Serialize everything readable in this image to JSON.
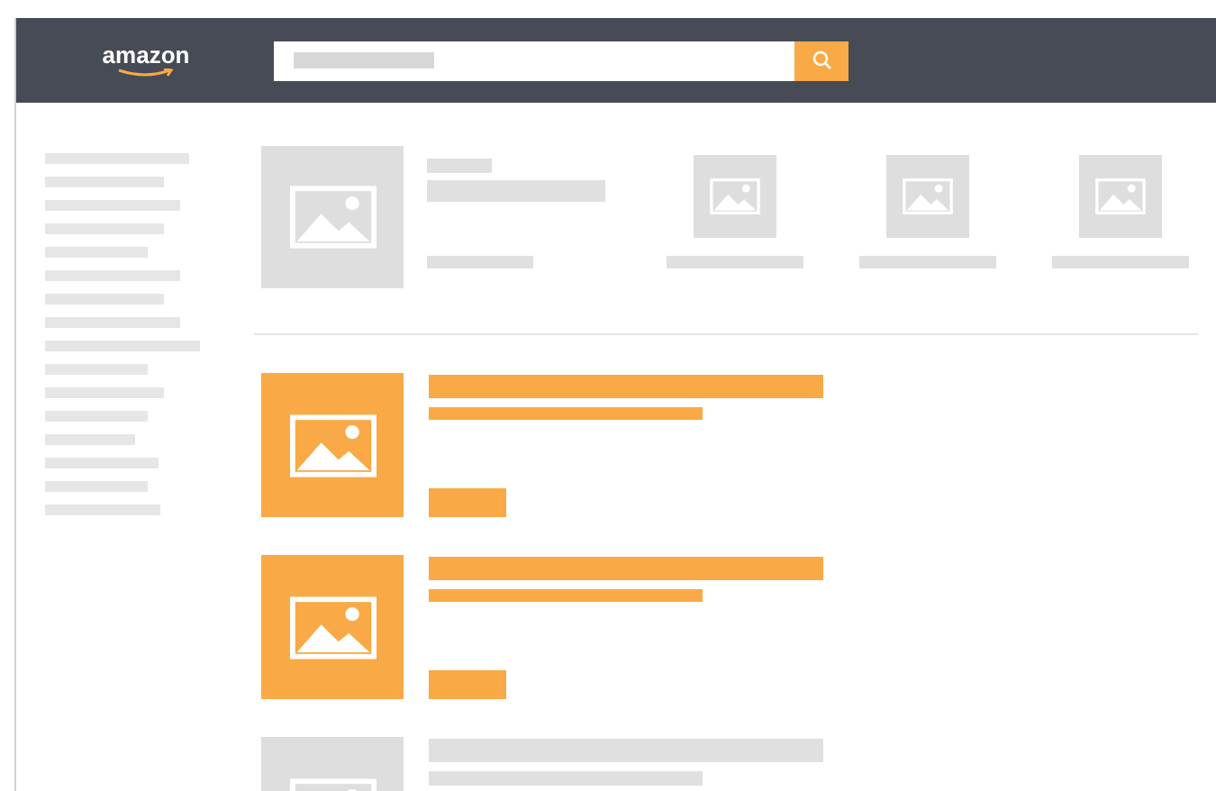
{
  "header": {
    "logo": "amazon"
  },
  "results": [
    {
      "highlighted": true
    },
    {
      "highlighted": true
    },
    {
      "highlighted": false
    }
  ]
}
